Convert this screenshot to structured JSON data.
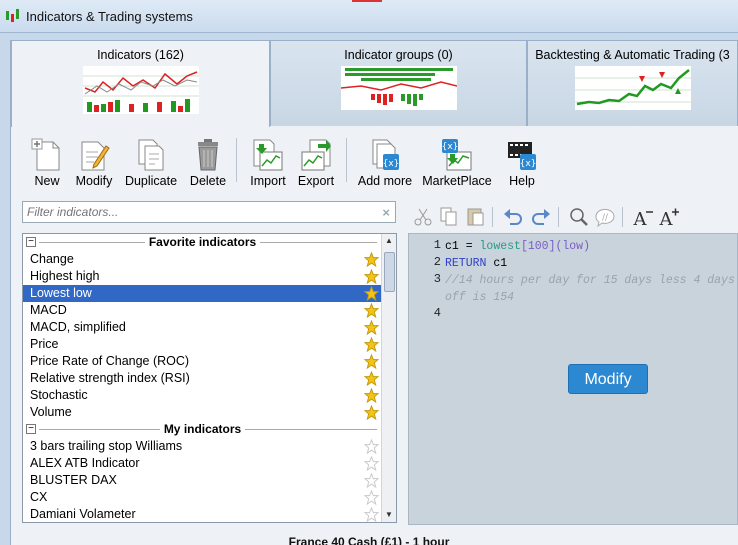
{
  "window": {
    "title": "Indicators & Trading systems"
  },
  "tabs": [
    {
      "label": "Indicators (162)"
    },
    {
      "label": "Indicator groups (0)"
    },
    {
      "label": "Backtesting & Automatic Trading (3"
    }
  ],
  "toolbar": {
    "new": "New",
    "modify": "Modify",
    "duplicate": "Duplicate",
    "delete": "Delete",
    "import": "Import",
    "export": "Export",
    "add_more": "Add more",
    "marketplace": "MarketPlace",
    "help": "Help"
  },
  "filter": {
    "placeholder": "Filter indicators...",
    "clear_icon": "×"
  },
  "favorites": {
    "title": "Favorite indicators",
    "items": [
      {
        "label": "Change"
      },
      {
        "label": "Highest high"
      },
      {
        "label": "Lowest low"
      },
      {
        "label": "MACD"
      },
      {
        "label": "MACD, simplified"
      },
      {
        "label": "Price"
      },
      {
        "label": "Price Rate of Change (ROC)"
      },
      {
        "label": "Relative strength index (RSI)"
      },
      {
        "label": "Stochastic"
      },
      {
        "label": "Volume"
      }
    ],
    "selected_index": 2
  },
  "my_indicators": {
    "title": "My indicators",
    "items": [
      {
        "label": "3 bars trailing stop Williams"
      },
      {
        "label": "ALEX ATB Indicator"
      },
      {
        "label": "BLUSTER DAX"
      },
      {
        "label": "CX"
      },
      {
        "label": "Damiani Volameter"
      }
    ]
  },
  "editor": {
    "line_numbers": [
      "1",
      "2",
      "3",
      "4"
    ],
    "modify_label": "Modify"
  },
  "code": {
    "l1_var": "c1 = ",
    "l1_fn": "lowest",
    "l1_open": "[",
    "l1_num": "100",
    "l1_close": "]",
    "l1_arg": "(low)",
    "l2_kw": "RETURN",
    "l2_rest": " c1",
    "l3_comment": "//14 hours per day for 15 days less 4 days",
    "l3b_comment": "off is 154"
  },
  "status": {
    "text": "France 40 Cash (£1) - 1 hour"
  },
  "colors": {
    "selected_row": "#3268c5",
    "modify_button": "#2d88d2",
    "star": "#f2c318"
  }
}
